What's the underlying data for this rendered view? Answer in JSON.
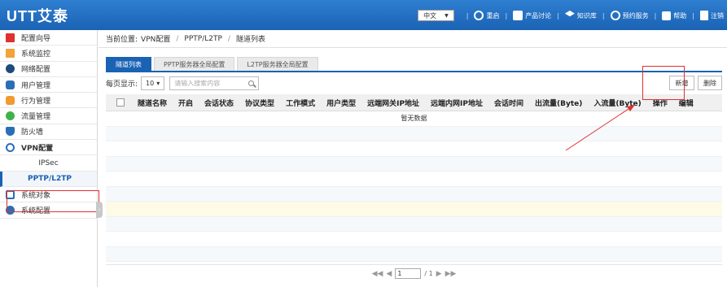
{
  "app": {
    "logo": "UTT艾泰"
  },
  "topnav": {
    "language": "中文",
    "items": [
      {
        "label": "重启",
        "icon": "power-icon"
      },
      {
        "label": "产品讨论",
        "icon": "chat-icon"
      },
      {
        "label": "知识库",
        "icon": "book-icon"
      },
      {
        "label": "预约服务",
        "icon": "service-icon"
      },
      {
        "label": "帮助",
        "icon": "help-icon"
      },
      {
        "label": "注销",
        "icon": "logout-icon"
      }
    ]
  },
  "sidebar": {
    "items": [
      {
        "label": "配置向导",
        "icon": "flag-icon",
        "color": "#e0302f"
      },
      {
        "label": "系统监控",
        "icon": "monitor-icon",
        "color": "#f2a33a"
      },
      {
        "label": "网络配置",
        "icon": "globe-icon",
        "color": "#1e4b7a"
      },
      {
        "label": "用户管理",
        "icon": "users-icon",
        "color": "#2a6fb6"
      },
      {
        "label": "行为管理",
        "icon": "hand-icon",
        "color": "#f29a2e"
      },
      {
        "label": "流量管理",
        "icon": "traffic-icon",
        "color": "#3fb24a"
      },
      {
        "label": "防火墙",
        "icon": "shield-icon",
        "color": "#2a6fb6"
      },
      {
        "label": "VPN配置",
        "icon": "vpn-icon",
        "color": "#2a6fb6"
      }
    ],
    "vpn_sub": [
      "IPSec",
      "PPTP/L2TP"
    ],
    "bottom_items": [
      {
        "label": "系统对象",
        "icon": "cube-icon",
        "color": "#2a6fb6"
      },
      {
        "label": "系统配置",
        "icon": "gear-icon",
        "color": "#2a6fb6"
      }
    ]
  },
  "breadcrumb": {
    "prefix": "当前位置:",
    "path": [
      "VPN配置",
      "PPTP/L2TP",
      "隧道列表"
    ]
  },
  "tabs": [
    "隧道列表",
    "PPTP服务器全局配置",
    "L2TP服务器全局配置"
  ],
  "toolbar": {
    "page_size_label": "每页显示:",
    "page_size": "10",
    "search_placeholder": "请输入搜索内容",
    "add": "新增",
    "delete": "删除"
  },
  "table": {
    "columns": [
      "隧道名称",
      "开启",
      "会话状态",
      "协议类型",
      "工作模式",
      "用户类型",
      "远端网关IP地址",
      "远端内网IP地址",
      "会话时间",
      "出流量(Byte)",
      "入流量(Byte)",
      "操作",
      "编辑"
    ],
    "empty_text": "暂无数据"
  },
  "pager": {
    "current": "1",
    "total": "/ 1"
  }
}
